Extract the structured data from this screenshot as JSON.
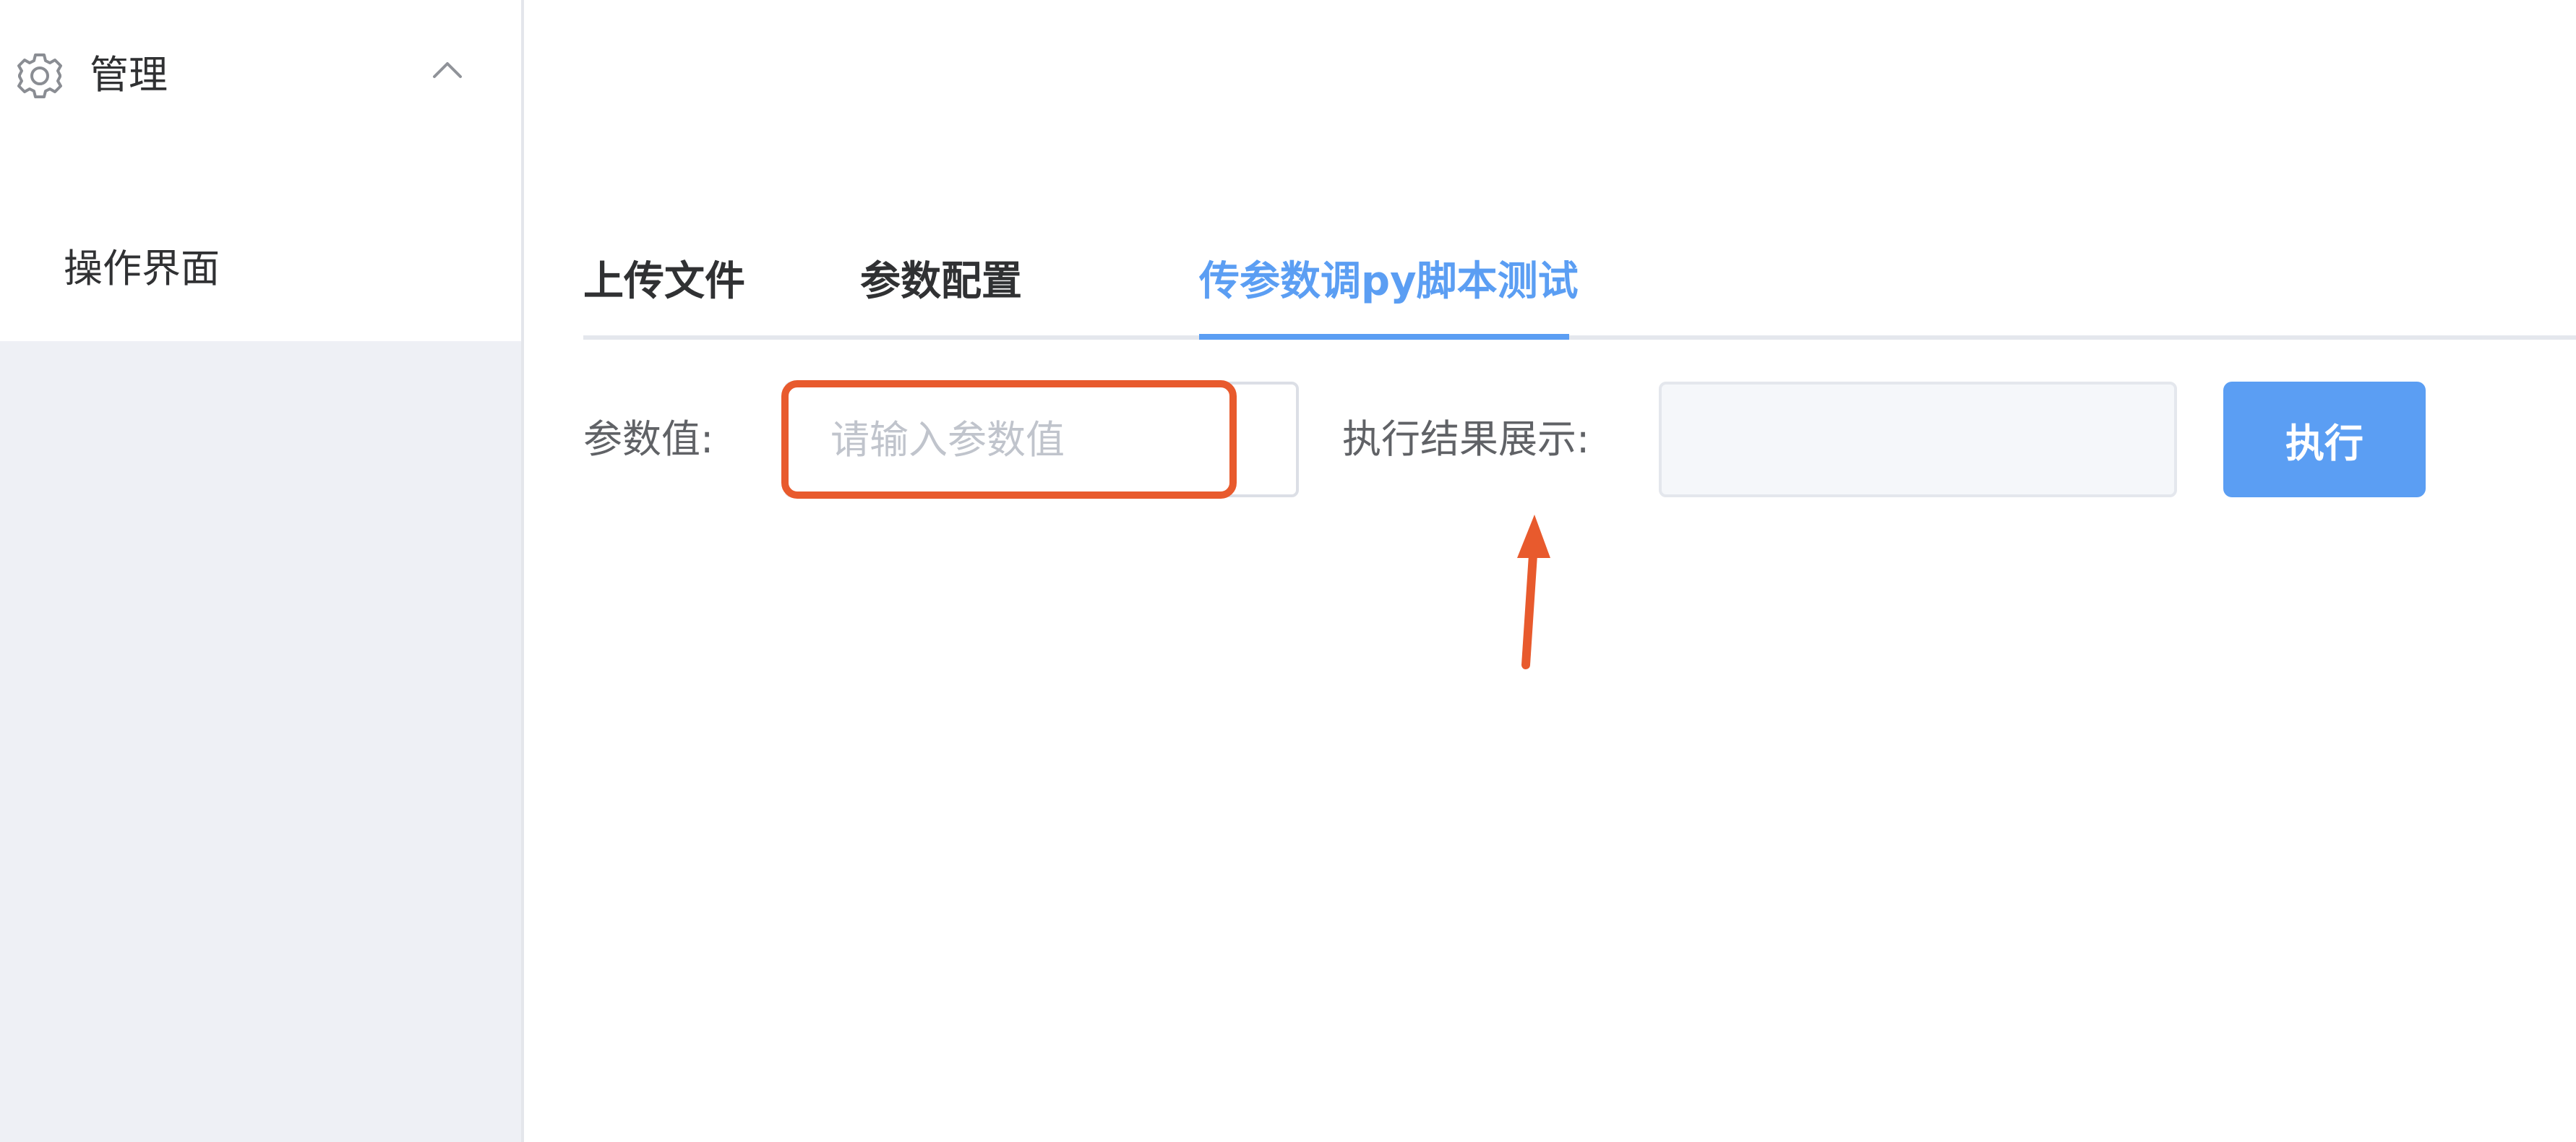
{
  "sidebar": {
    "submenu": {
      "title": "管理",
      "icon": "gear-icon",
      "expanded": true,
      "chevron_icon": "chevron-up-icon"
    },
    "items": [
      {
        "label": "操作界面"
      }
    ]
  },
  "tabs": [
    {
      "label": "上传文件",
      "active": false
    },
    {
      "label": "参数配置",
      "active": false
    },
    {
      "label": "传参数调py脚本测试",
      "active": true
    }
  ],
  "form": {
    "param_label": "参数值:",
    "param_input": {
      "value": "",
      "placeholder": "请输入参数值"
    },
    "result_label": "执行结果展示:",
    "result_value": "",
    "execute_button": "执行"
  },
  "colors": {
    "accent": "#5b9ef3",
    "annotation": "#e85a2d",
    "sidebar_bg": "#eef0f5",
    "text": "#303133"
  }
}
